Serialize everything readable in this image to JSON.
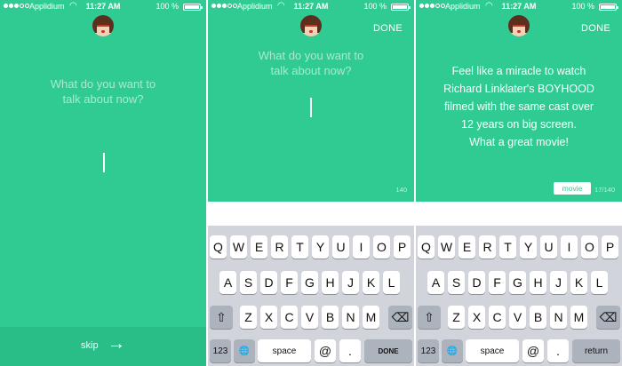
{
  "status_bar": {
    "carrier": "Applidium",
    "time": "11:27 AM",
    "battery": "100 %"
  },
  "screen1": {
    "prompt_line1": "What do you want to",
    "prompt_line2": "talk about now?",
    "skip_label": "skip",
    "skip_arrow": "→"
  },
  "screen2": {
    "done_label": "DONE",
    "prompt_line1": "What do you want to",
    "prompt_line2": "talk about now?",
    "counter": "140"
  },
  "screen3": {
    "done_label": "DONE",
    "post_text": "Feel like a miracle to watch\nRichard Linklater's BOYHOOD\nfilmed with the same cast over\n12 years on big screen.\nWhat a great movie!",
    "tag_label": "movie",
    "counter": "17/140"
  },
  "keyboard": {
    "row1": [
      "Q",
      "W",
      "E",
      "R",
      "T",
      "Y",
      "U",
      "I",
      "O",
      "P"
    ],
    "row2": [
      "A",
      "S",
      "D",
      "F",
      "G",
      "H",
      "J",
      "K",
      "L"
    ],
    "row3": [
      "Z",
      "X",
      "C",
      "V",
      "B",
      "N",
      "M"
    ],
    "shift_icon": "⇧",
    "delete_icon": "⌫",
    "numbers_label": "123",
    "globe_icon": "🌐",
    "space_label": "space",
    "at_label": "@",
    "dot_label": ".",
    "done_label": "DONE",
    "return_label": "return"
  },
  "colors": {
    "accent_green": "#2fcb93",
    "skip_bar_green": "#29bd88",
    "keyboard_bg": "#d1d5db"
  },
  "icons": {
    "signal": "signal-dots-icon",
    "wifi": "wifi-icon",
    "battery": "battery-icon",
    "avatar": "user-avatar-icon"
  }
}
